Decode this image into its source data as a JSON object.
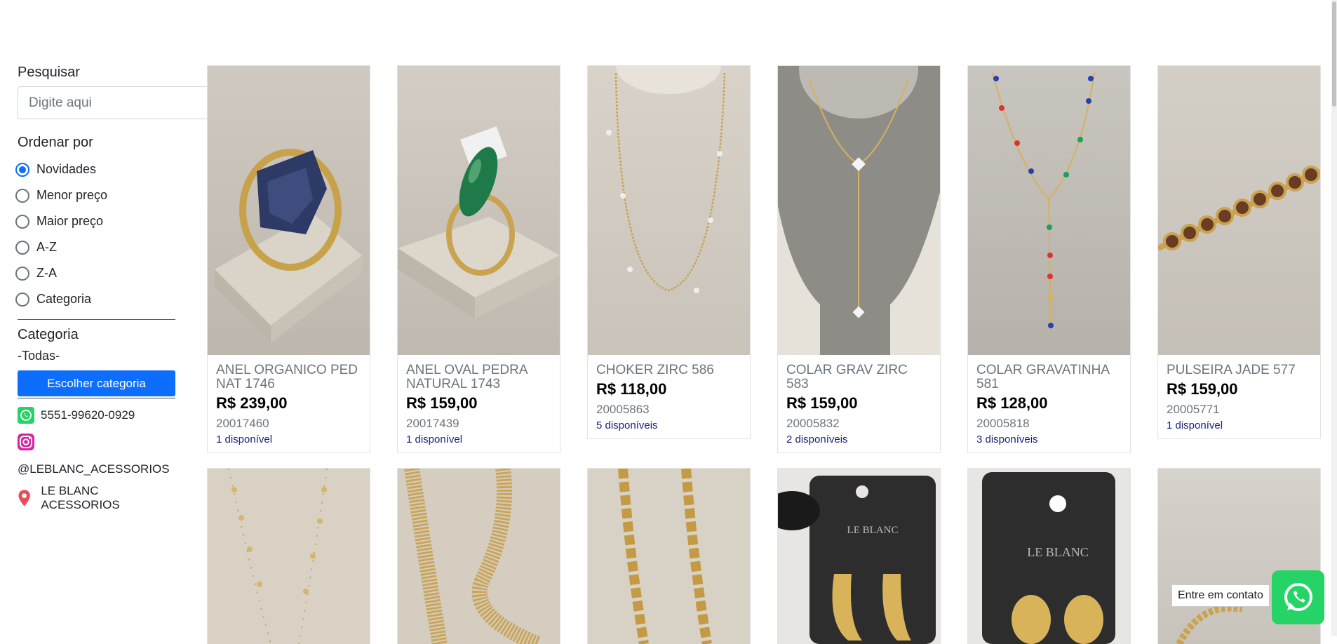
{
  "sidebar": {
    "search_title": "Pesquisar",
    "search_placeholder": "Digite aqui",
    "sort_title": "Ordenar por",
    "sort_options": [
      "Novidades",
      "Menor preço",
      "Maior preço",
      "A-Z",
      "Z-A",
      "Categoria"
    ],
    "sort_selected": "Novidades",
    "category_title": "Categoria",
    "category_value": "-Todas-",
    "category_button": "Escolher categoria",
    "phone": "5551-99620-0929",
    "instagram": "@LEBLANC_ACESSORIOS",
    "location": "LE BLANC ACESSORIOS"
  },
  "products": [
    {
      "name": "ANEL ORGANICO PED NAT 1746",
      "price": "R$ 239,00",
      "code": "20017460",
      "stock": "1 disponível"
    },
    {
      "name": "ANEL OVAL PEDRA NATURAL 1743",
      "price": "R$ 159,00",
      "code": "20017439",
      "stock": "1 disponível"
    },
    {
      "name": "CHOKER ZIRC 586",
      "price": "R$ 118,00",
      "code": "20005863",
      "stock": "5 disponíveis"
    },
    {
      "name": "COLAR GRAV ZIRC 583",
      "price": "R$ 159,00",
      "code": "20005832",
      "stock": "2 disponíveis"
    },
    {
      "name": "COLAR GRAVATINHA 581",
      "price": "R$ 128,00",
      "code": "20005818",
      "stock": "3 disponíveis"
    },
    {
      "name": "PULSEIRA JADE 577",
      "price": "R$ 159,00",
      "code": "20005771",
      "stock": "1 disponível"
    }
  ],
  "whatsapp_tooltip": "Entre em contato",
  "colors": {
    "primary": "#0d6efd",
    "whatsapp": "#25d366",
    "stock": "#1a237e"
  }
}
